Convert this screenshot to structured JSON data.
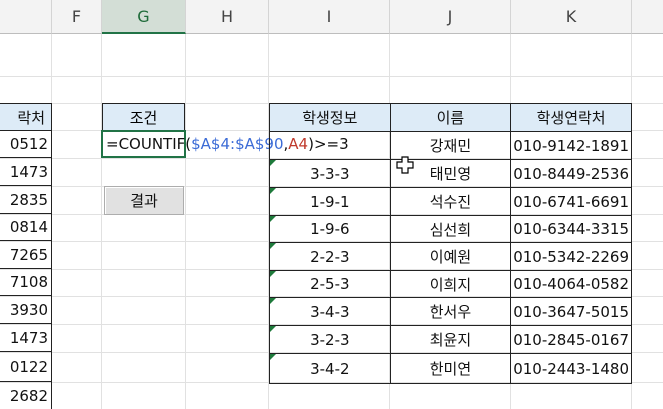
{
  "columns": [
    "F",
    "G",
    "H",
    "I",
    "J",
    "K"
  ],
  "selected_column": "G",
  "left_column": {
    "header": "락처",
    "values": [
      "0512",
      "1473",
      "2835",
      "0814",
      "7265",
      "7108",
      "3930",
      "1473",
      "0122",
      "2682"
    ]
  },
  "condition": {
    "header": "조건",
    "formula_prefix": "=COUNTIF(",
    "formula_ref_range": "$A$4:$A$90",
    "formula_comma": ",",
    "formula_ref_cell": "A4",
    "formula_suffix": ")>=3"
  },
  "result_button": {
    "label": "결과"
  },
  "table": {
    "headers": [
      "학생정보",
      "이름",
      "학생연락처"
    ],
    "rows": [
      {
        "info": "",
        "name": "강재민",
        "phone": "010-9142-1891"
      },
      {
        "info": "3-3-3",
        "name": "태민영",
        "phone": "010-8449-2536"
      },
      {
        "info": "1-9-1",
        "name": "석수진",
        "phone": "010-6741-6691"
      },
      {
        "info": "1-9-6",
        "name": "심선희",
        "phone": "010-6344-3315"
      },
      {
        "info": "2-2-3",
        "name": "이예원",
        "phone": "010-5342-2269"
      },
      {
        "info": "2-5-3",
        "name": "이희지",
        "phone": "010-4064-0582"
      },
      {
        "info": "3-4-3",
        "name": "한서우",
        "phone": "010-3647-5015"
      },
      {
        "info": "3-2-3",
        "name": "최윤지",
        "phone": "010-2845-0167"
      },
      {
        "info": "3-4-2",
        "name": "한미연",
        "phone": "010-2443-1480"
      }
    ]
  },
  "colors": {
    "accent": "#217346",
    "header_fill": "#ddebf7",
    "ref_blue": "#3b6bd6",
    "ref_red": "#c0392b"
  },
  "icons": {
    "cursor": "plus-cursor-icon"
  }
}
